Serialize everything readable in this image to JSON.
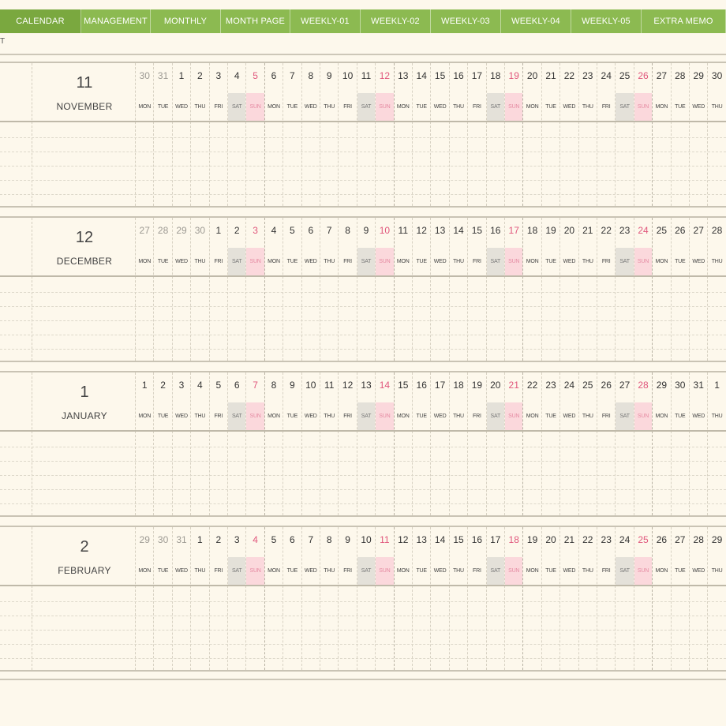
{
  "nav": {
    "tabs": [
      "CALENDAR",
      "MANAGEMENT",
      "MONTHLY",
      "MONTH PAGE",
      "WEEKLY-01",
      "WEEKLY-02",
      "WEEKLY-03",
      "WEEKLY-04",
      "WEEKLY-05",
      "EXTRA MEMO"
    ]
  },
  "corner_text": "T",
  "colors": {
    "nav_green": "#8cba51",
    "background": "#fdf8ec",
    "sunday": "#e0567c",
    "saturday_fill": "#e4e1d9",
    "sunday_fill": "#fbd8dc"
  },
  "weekday_labels": [
    "MON",
    "TUE",
    "WED",
    "THU",
    "FRI",
    "SAT",
    "SUN"
  ],
  "months": [
    {
      "number": "11",
      "name": "NOVEMBER",
      "days": [
        "30",
        "31",
        "1",
        "2",
        "3",
        "4",
        "5",
        "6",
        "7",
        "8",
        "9",
        "10",
        "11",
        "12",
        "13",
        "14",
        "15",
        "16",
        "17",
        "18",
        "19",
        "20",
        "21",
        "22",
        "23",
        "24",
        "25",
        "26",
        "27",
        "28",
        "29",
        "30"
      ],
      "other_month_count": 2
    },
    {
      "number": "12",
      "name": "DECEMBER",
      "days": [
        "27",
        "28",
        "29",
        "30",
        "1",
        "2",
        "3",
        "4",
        "5",
        "6",
        "7",
        "8",
        "9",
        "10",
        "11",
        "12",
        "13",
        "14",
        "15",
        "16",
        "17",
        "18",
        "19",
        "20",
        "21",
        "22",
        "23",
        "24",
        "25",
        "26",
        "27",
        "28"
      ],
      "other_month_count": 4
    },
    {
      "number": "1",
      "name": "JANUARY",
      "days": [
        "1",
        "2",
        "3",
        "4",
        "5",
        "6",
        "7",
        "8",
        "9",
        "10",
        "11",
        "12",
        "13",
        "14",
        "15",
        "16",
        "17",
        "18",
        "19",
        "20",
        "21",
        "22",
        "23",
        "24",
        "25",
        "26",
        "27",
        "28",
        "29",
        "30",
        "31",
        "1"
      ],
      "other_month_count": 0
    },
    {
      "number": "2",
      "name": "FEBRUARY",
      "days": [
        "29",
        "30",
        "31",
        "1",
        "2",
        "3",
        "4",
        "5",
        "6",
        "7",
        "8",
        "9",
        "10",
        "11",
        "12",
        "13",
        "14",
        "15",
        "16",
        "17",
        "18",
        "19",
        "20",
        "21",
        "22",
        "23",
        "24",
        "25",
        "26",
        "27",
        "28",
        "29"
      ],
      "other_month_count": 3
    }
  ]
}
